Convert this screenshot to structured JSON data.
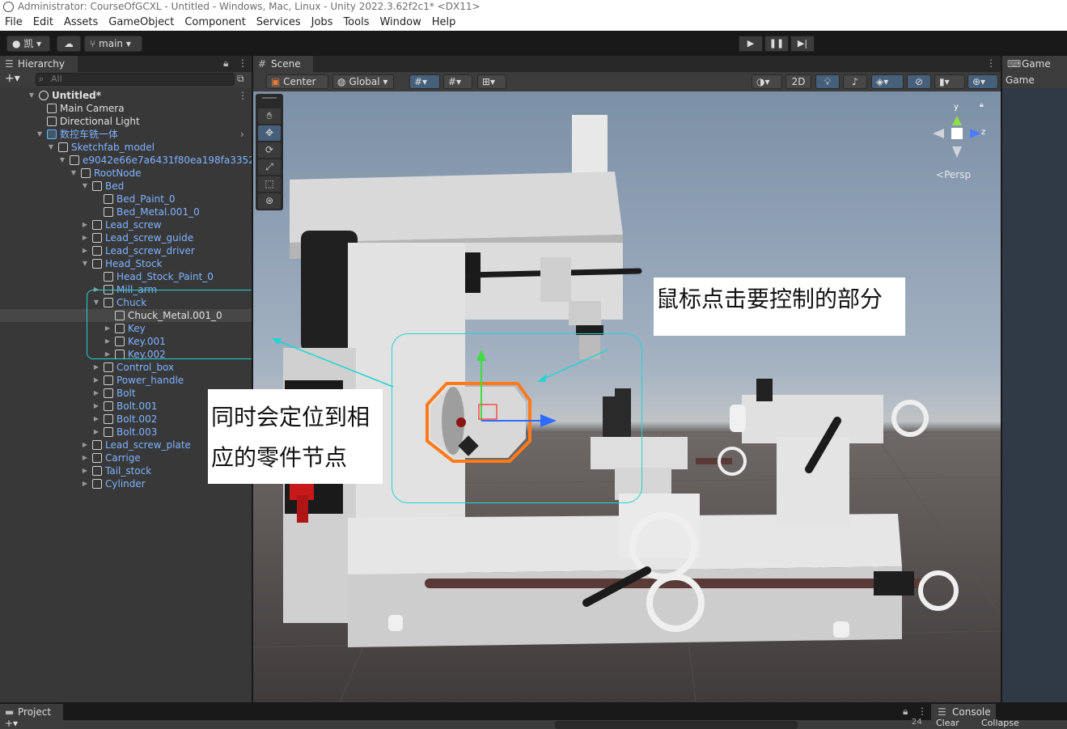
{
  "window": {
    "title": "Administrator: CourseOfGCXL - Untitled - Windows, Mac, Linux - Unity 2022.3.62f2c1* <DX11>"
  },
  "menu": [
    "File",
    "Edit",
    "Assets",
    "GameObject",
    "Component",
    "Services",
    "Jobs",
    "Tools",
    "Window",
    "Help"
  ],
  "toolbar": {
    "account_label": "凯",
    "branch_label": "main"
  },
  "hierarchy": {
    "tab_label": "Hierarchy",
    "search_placeholder": "All",
    "rows": [
      {
        "label": "Untitled*",
        "style": "scene"
      },
      {
        "label": "Main Camera",
        "style": "white"
      },
      {
        "label": "Directional Light",
        "style": "white"
      },
      {
        "label": "数控车铣一体",
        "style": "prefab"
      },
      {
        "label": "Sketchfab_model",
        "style": "prefab"
      },
      {
        "label": "e9042e66e7a6431f80ea198fa3352",
        "style": "prefab"
      },
      {
        "label": "RootNode",
        "style": "prefab"
      },
      {
        "label": "Bed",
        "style": "prefab"
      },
      {
        "label": "Bed_Paint_0",
        "style": "prefab"
      },
      {
        "label": "Bed_Metal.001_0",
        "style": "prefab"
      },
      {
        "label": "Lead_screw",
        "style": "prefab"
      },
      {
        "label": "Lead_screw_guide",
        "style": "prefab"
      },
      {
        "label": "Lead_screw_driver",
        "style": "prefab"
      },
      {
        "label": "Head_Stock",
        "style": "prefab"
      },
      {
        "label": "Head_Stock_Paint_0",
        "style": "prefab"
      },
      {
        "label": "Mill_arm",
        "style": "prefab"
      },
      {
        "label": "Chuck",
        "style": "prefab"
      },
      {
        "label": "Chuck_Metal.001_0",
        "style": "white"
      },
      {
        "label": "Key",
        "style": "prefab"
      },
      {
        "label": "Key.001",
        "style": "prefab"
      },
      {
        "label": "Key.002",
        "style": "prefab"
      },
      {
        "label": "Control_box",
        "style": "prefab"
      },
      {
        "label": "Power_handle",
        "style": "prefab"
      },
      {
        "label": "Bolt",
        "style": "prefab"
      },
      {
        "label": "Bolt.001",
        "style": "prefab"
      },
      {
        "label": "Bolt.002",
        "style": "prefab"
      },
      {
        "label": "Bolt.003",
        "style": "prefab"
      },
      {
        "label": "Lead_screw_plate",
        "style": "prefab"
      },
      {
        "label": "Carrige",
        "style": "prefab"
      },
      {
        "label": "Tail_stock",
        "style": "prefab"
      },
      {
        "label": "Cylinder",
        "style": "prefab"
      }
    ]
  },
  "scene": {
    "tab_label": "Scene",
    "pivot_label": "Center",
    "space_label": "Global",
    "mode_2d_label": "2D",
    "persp_label": "Persp",
    "gizmo_y": "y",
    "gizmo_z": "z"
  },
  "game": {
    "tab_label": "Game",
    "toolbar_label": "Game"
  },
  "annotations": {
    "right": "鼠标点击要控制的部分",
    "left_line1": "同时会定位到相",
    "left_line2": "应的零件节点"
  },
  "bottom": {
    "project_tab": "Project",
    "console_tab": "Console",
    "console_count": "24",
    "clear_label": "Clear",
    "collapse_label": "Collapse"
  },
  "colors": {
    "prefab_blue": "#7fb3ff",
    "selection_orange": "#ff7a1a",
    "callout_cyan": "#22d4d4",
    "panel_bg": "#383838"
  }
}
